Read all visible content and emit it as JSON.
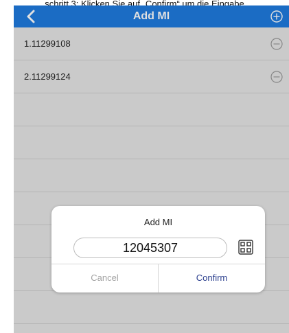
{
  "caption": "schritt 3: Klicken Sie auf „Confirm“ um die Eingabe",
  "nav": {
    "title": "Add MI"
  },
  "list": [
    {
      "label": "1.11299108"
    },
    {
      "label": "2.11299124"
    },
    {
      "label": ""
    },
    {
      "label": ""
    },
    {
      "label": ""
    },
    {
      "label": ""
    },
    {
      "label": ""
    },
    {
      "label": ""
    },
    {
      "label": ""
    }
  ],
  "dialog": {
    "title": "Add MI",
    "input_value": "12045307",
    "cancel_label": "Cancel",
    "confirm_label": "Confirm"
  },
  "colors": {
    "nav_bar": "#1f7be0",
    "confirm_text": "#2b3f8e",
    "cancel_text": "#a3a3a3"
  },
  "icons": {
    "back": "chevron-left-icon",
    "add": "plus-circle-icon",
    "remove": "minus-circle-icon",
    "scan": "qr-scan-icon"
  }
}
